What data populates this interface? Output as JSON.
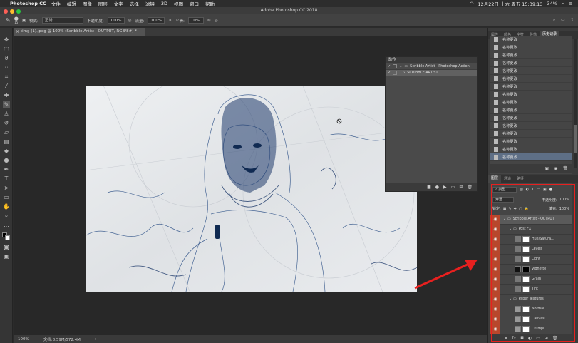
{
  "menubar": {
    "app_name": "Photoshop CC",
    "menus": [
      "文件",
      "编辑",
      "图像",
      "图层",
      "文字",
      "选择",
      "滤镜",
      "3D",
      "视图",
      "窗口",
      "帮助"
    ],
    "datetime": "12月22日 十六 周五 15:39:13",
    "battery": "34%"
  },
  "window": {
    "title": "Adobe Photoshop CC 2018"
  },
  "options_bar": {
    "mode_label": "模式:",
    "mode_value": "正常",
    "opacity_label": "不透明度:",
    "opacity_value": "100%",
    "flow_label": "流量:",
    "flow_value": "100%",
    "smooth_label": "平滑:",
    "smooth_value": "10%",
    "brush_size": "15"
  },
  "document": {
    "tab_label": "timg (1).jpeg @ 100% (Scribble Artist - OUTPUT, RGB/8#) *"
  },
  "status_bar": {
    "zoom": "100%",
    "doc_size": "文档:8.59M/572.4M"
  },
  "actions_panel": {
    "title": "动作",
    "rows": [
      {
        "label": "Scribble Artist - Photoshop Action",
        "checked": true
      },
      {
        "label": "SCRIBBLE ARTIST",
        "checked": true
      }
    ]
  },
  "top_panel_tabs": [
    "属性",
    "颜色",
    "字符",
    "段落",
    "历史记录"
  ],
  "history": {
    "items": [
      "名称更改",
      "名称更改",
      "名称更改",
      "名称更改",
      "名称更改",
      "名称更改",
      "名称更改",
      "名称更改",
      "名称更改",
      "名称更改",
      "名称更改",
      "名称更改",
      "名称更改",
      "名称更改",
      "名称更改",
      "名称更改"
    ]
  },
  "layer_panel_tabs": [
    "图层",
    "通道",
    "路径"
  ],
  "layers": {
    "kind_filter": "类型",
    "blend_mode": "穿透",
    "opacity_label": "不透明度:",
    "opacity_value": "100%",
    "lock_label": "锁定:",
    "fill_label": "填充:",
    "fill_value": "100%",
    "items": [
      {
        "name": "Scribble Artist - OUTPUT",
        "kind": "group"
      },
      {
        "name": "Post FX",
        "kind": "group"
      },
      {
        "name": "Hue/Satura...",
        "kind": "adjust"
      },
      {
        "name": "Levels",
        "kind": "adjust"
      },
      {
        "name": "Light",
        "kind": "adjust"
      },
      {
        "name": "Vignette",
        "kind": "adjust"
      },
      {
        "name": "Grain",
        "kind": "adjust"
      },
      {
        "name": "Tint",
        "kind": "adjust"
      },
      {
        "name": "Paper Textures",
        "kind": "group"
      },
      {
        "name": "Normal",
        "kind": "texture"
      },
      {
        "name": "Canvas",
        "kind": "texture"
      },
      {
        "name": "Crumpl...",
        "kind": "texture"
      }
    ]
  },
  "colors": {
    "highlight_red": "#e8201f",
    "eye_column": "#b8472c",
    "selected_history": "#5e6f86"
  }
}
